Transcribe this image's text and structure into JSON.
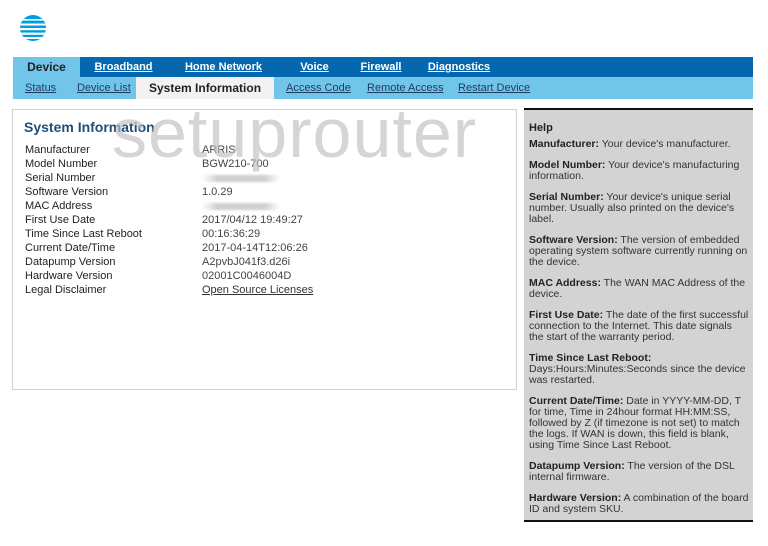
{
  "brand": {
    "logo": "att-globe-logo",
    "color": "#0568ae"
  },
  "topnav": {
    "tabs": [
      {
        "label": "Device",
        "active": true
      },
      {
        "label": "Broadband"
      },
      {
        "label": "Home Network"
      },
      {
        "label": "Voice"
      },
      {
        "label": "Firewall"
      },
      {
        "label": "Diagnostics"
      }
    ]
  },
  "subnav": {
    "tabs": [
      {
        "label": "Status"
      },
      {
        "label": "Device List"
      },
      {
        "label": "System Information",
        "active": true
      },
      {
        "label": "Access Code"
      },
      {
        "label": "Remote Access"
      },
      {
        "label": "Restart Device"
      }
    ]
  },
  "watermark": "setuprouter",
  "system_info": {
    "title": "System Information",
    "rows": [
      {
        "label": "Manufacturer",
        "value": "ARRIS"
      },
      {
        "label": "Model Number",
        "value": "BGW210-700"
      },
      {
        "label": "Serial Number",
        "value": ""
      },
      {
        "label": "Software Version",
        "value": "1.0.29"
      },
      {
        "label": "MAC Address",
        "value": ""
      },
      {
        "label": "First Use Date",
        "value": "2017/04/12 19:49:27"
      },
      {
        "label": "Time Since Last Reboot",
        "value": "00:16:36:29"
      },
      {
        "label": "Current Date/Time",
        "value": "2017-04-14T12:06:26"
      },
      {
        "label": "Datapump Version",
        "value": "A2pvbJ041f3.d26i"
      },
      {
        "label": "Hardware Version",
        "value": "02001C0046004D"
      },
      {
        "label": "Legal Disclaimer",
        "value": "Open Source Licenses"
      }
    ]
  },
  "help": {
    "title": "Help",
    "items": [
      {
        "term": "Manufacturer:",
        "text": " Your device's manufacturer."
      },
      {
        "term": "Model Number:",
        "text": " Your device's manufacturing information."
      },
      {
        "term": "Serial Number:",
        "text": " Your device's unique serial number. Usually also printed on the device's label."
      },
      {
        "term": "Software Version:",
        "text": " The version of embedded operating system software currently running on the device."
      },
      {
        "term": "MAC Address:",
        "text": " The WAN MAC Address of the device."
      },
      {
        "term": "First Use Date:",
        "text": " The date of the first successful connection to the Internet. This date signals the start of the warranty period."
      },
      {
        "term": "Time Since Last Reboot:",
        "text": "Days:Hours:Minutes:Seconds since the device was restarted."
      },
      {
        "term": "Current Date/Time:",
        "text": " Date in YYYY-MM-DD, T for time, Time in 24hour format HH:MM:SS, followed by Z (if timezone is not set) to match the logs. If WAN is down, this field is blank, using Time Since Last Reboot."
      },
      {
        "term": "Datapump Version:",
        "text": " The version of the DSL internal firmware."
      },
      {
        "term": "Hardware Version:",
        "text": " A combination of the board ID and system SKU."
      }
    ]
  }
}
